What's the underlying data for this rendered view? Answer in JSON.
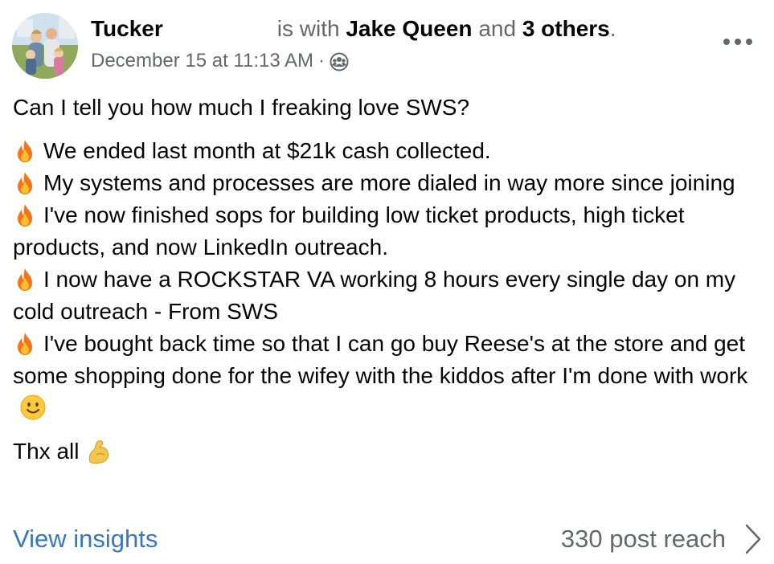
{
  "header": {
    "author": "Tucker",
    "with_text": "is with",
    "tagged_name": "Jake Queen",
    "and_text": "and",
    "others": "3 others",
    "period": ".",
    "timestamp": "December 15 at 11:13 AM",
    "separator": "·",
    "audience_icon": "group-audience-icon",
    "more_icon": "more-options-icon"
  },
  "post": {
    "intro": "Can I tell you how much I freaking love SWS?",
    "bullet_icon": "fire-emoji",
    "bullets": [
      "We ended last month at $21k cash collected.",
      "My systems and processes are more dialed in way more since joining",
      "I've now finished sops for building low ticket products, high ticket products, and now LinkedIn outreach.",
      "I now have a ROCKSTAR VA working 8 hours every single day on my cold outreach - From SWS",
      "I've bought back time so that I can go buy Reese's at the store and get some shopping done for the wifey with the kiddos after I'm done with work"
    ],
    "last_bullet_emoji": "smiling-face-emoji",
    "closing": "Thx all",
    "closing_emoji": "flexed-biceps-emoji"
  },
  "footer": {
    "insights_label": "View insights",
    "reach_label": "330 post reach",
    "reach_icon": "chevron-right-icon"
  },
  "colors": {
    "link": "#3578c2",
    "secondary_text": "#65676b",
    "primary_text": "#050505"
  }
}
